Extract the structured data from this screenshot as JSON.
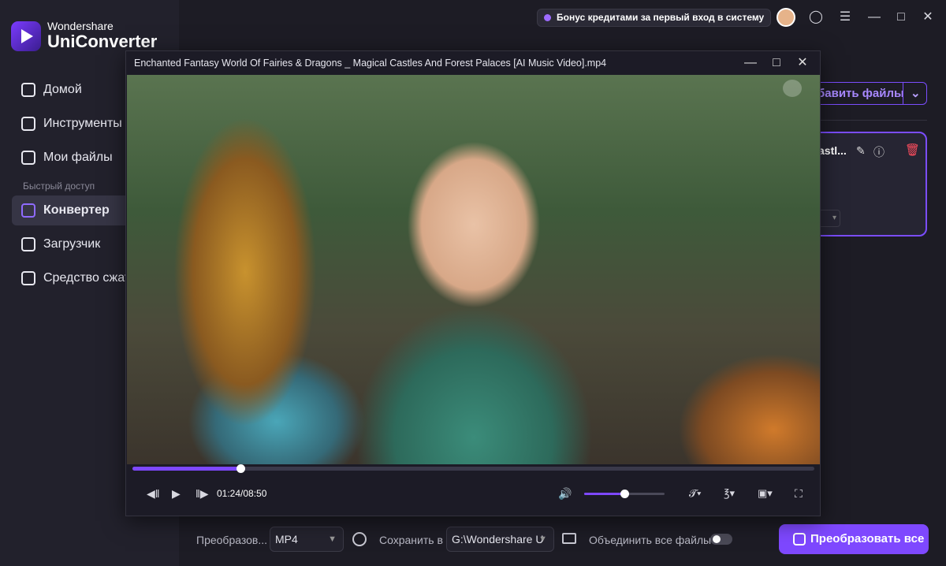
{
  "brand": {
    "line1": "Wondershare",
    "line2": "UniConverter"
  },
  "sidebar": {
    "items": [
      {
        "label": "Домой",
        "icon": "home-icon"
      },
      {
        "label": "Инструменты с",
        "icon": "toolbox-icon"
      },
      {
        "label": "Мои файлы",
        "icon": "files-icon"
      }
    ],
    "section_label": "Быстрый доступ",
    "quick": [
      {
        "label": "Конвертер",
        "icon": "converter-icon",
        "active": true
      },
      {
        "label": "Загрузчик",
        "icon": "download-icon"
      },
      {
        "label": "Средство сжат",
        "icon": "compress-icon"
      }
    ]
  },
  "topbar": {
    "bonus_text": "Бонус кредитами за первый вход в систему"
  },
  "main": {
    "add_files_label": "бавить файлы",
    "file_card": {
      "name": "astl..."
    }
  },
  "player": {
    "title": "Enchanted Fantasy World Of Fairies & Dragons _ Magical Castles And Forest Palaces [AI Music Video].mp4",
    "time": "01:24/08:50",
    "progress": 0.158,
    "volume": 0.5
  },
  "bottombar": {
    "convert_label": "Преобразов...",
    "format_value": "MP4",
    "save_label": "Сохранить в",
    "save_path": "G:\\Wondershare U",
    "merge_label": "Объединить все файлы",
    "merge_enabled": false,
    "convert_all_label": "Преобразовать все"
  },
  "colors": {
    "accent": "#7e48ff",
    "danger": "#ff4d5e"
  }
}
